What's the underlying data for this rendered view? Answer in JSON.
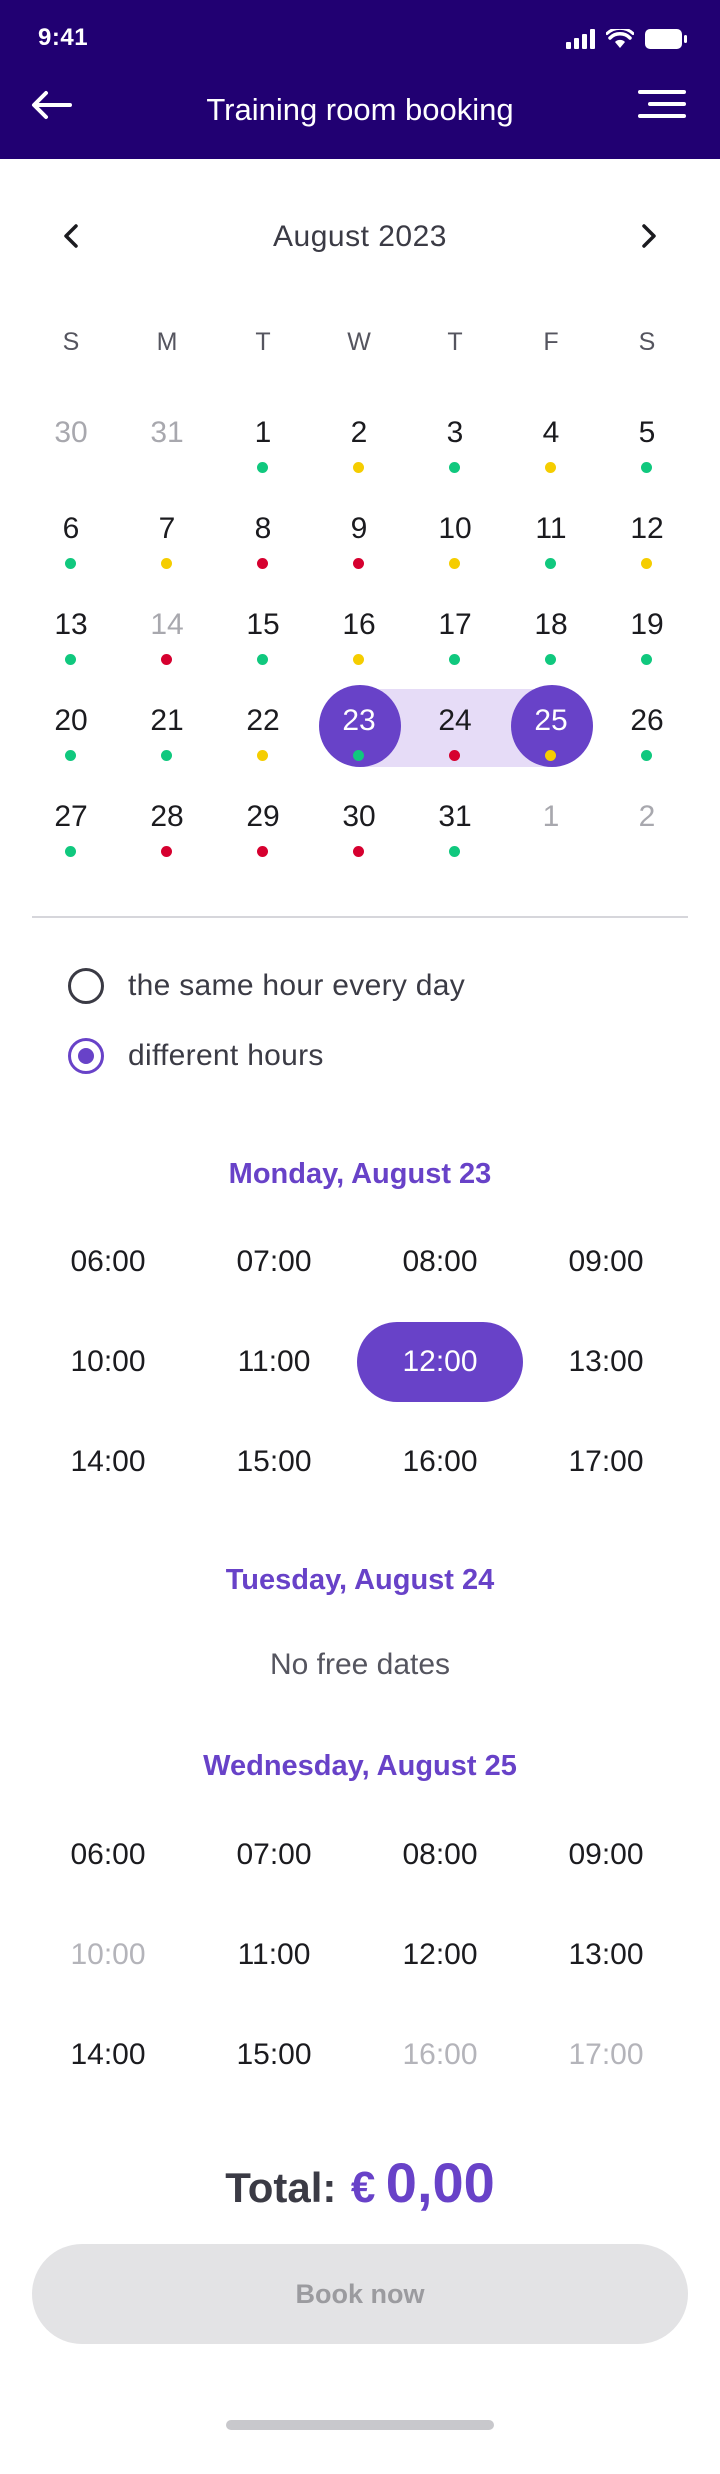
{
  "status_bar": {
    "time": "9:41",
    "icons": [
      "signal-icon",
      "wifi-icon",
      "battery-icon"
    ]
  },
  "header": {
    "title": "Training room booking",
    "back_icon": "arrow-left-icon",
    "menu_icon": "menu-icon"
  },
  "calendar": {
    "month_label": "August 2023",
    "weekdays": [
      "S",
      "M",
      "T",
      "W",
      "T",
      "F",
      "S"
    ],
    "weeks": [
      [
        {
          "day": "30",
          "other": true
        },
        {
          "day": "31",
          "other": true
        },
        {
          "day": "1",
          "status": "green"
        },
        {
          "day": "2",
          "status": "yellow"
        },
        {
          "day": "3",
          "status": "green"
        },
        {
          "day": "4",
          "status": "yellow"
        },
        {
          "day": "5",
          "status": "green"
        }
      ],
      [
        {
          "day": "6",
          "status": "green"
        },
        {
          "day": "7",
          "status": "yellow"
        },
        {
          "day": "8",
          "status": "red"
        },
        {
          "day": "9",
          "status": "red"
        },
        {
          "day": "10",
          "status": "yellow"
        },
        {
          "day": "11",
          "status": "green"
        },
        {
          "day": "12",
          "status": "yellow"
        }
      ],
      [
        {
          "day": "13",
          "status": "green"
        },
        {
          "day": "14",
          "status": "red",
          "dim": true
        },
        {
          "day": "15",
          "status": "green"
        },
        {
          "day": "16",
          "status": "yellow"
        },
        {
          "day": "17",
          "status": "green"
        },
        {
          "day": "18",
          "status": "green"
        },
        {
          "day": "19",
          "status": "green"
        }
      ],
      [
        {
          "day": "20",
          "status": "green"
        },
        {
          "day": "21",
          "status": "green"
        },
        {
          "day": "22",
          "status": "yellow"
        },
        {
          "day": "23",
          "status": "green",
          "selected": true
        },
        {
          "day": "24",
          "status": "red",
          "in_range": true
        },
        {
          "day": "25",
          "status": "yellow",
          "selected": true
        },
        {
          "day": "26",
          "status": "green"
        }
      ],
      [
        {
          "day": "27",
          "status": "green"
        },
        {
          "day": "28",
          "status": "red"
        },
        {
          "day": "29",
          "status": "red"
        },
        {
          "day": "30",
          "status": "red"
        },
        {
          "day": "31",
          "status": "green"
        },
        {
          "day": "1",
          "other": true
        },
        {
          "day": "2",
          "other": true
        }
      ]
    ],
    "colors": {
      "green": "#10c87e",
      "yellow": "#f5cd00",
      "red": "#d6002f",
      "accent": "#6842c8",
      "range": "#e6dcf7",
      "header": "#210072"
    }
  },
  "options": {
    "same_hour_label": "the same hour every day",
    "different_hours_label": "different hours",
    "selected": "different_hours"
  },
  "days": [
    {
      "heading": "Monday, August 23",
      "slots": [
        {
          "time": "06:00"
        },
        {
          "time": "07:00"
        },
        {
          "time": "08:00"
        },
        {
          "time": "09:00"
        },
        {
          "time": "10:00"
        },
        {
          "time": "11:00"
        },
        {
          "time": "12:00",
          "selected": true
        },
        {
          "time": "13:00"
        },
        {
          "time": "14:00"
        },
        {
          "time": "15:00"
        },
        {
          "time": "16:00"
        },
        {
          "time": "17:00"
        }
      ]
    },
    {
      "heading": "Tuesday, August 24",
      "empty_text": "No free dates",
      "slots": []
    },
    {
      "heading": "Wednesday, August 25",
      "slots": [
        {
          "time": "06:00"
        },
        {
          "time": "07:00"
        },
        {
          "time": "08:00"
        },
        {
          "time": "09:00"
        },
        {
          "time": "10:00",
          "disabled": true
        },
        {
          "time": "11:00"
        },
        {
          "time": "12:00"
        },
        {
          "time": "13:00"
        },
        {
          "time": "14:00"
        },
        {
          "time": "15:00"
        },
        {
          "time": "16:00",
          "disabled": true
        },
        {
          "time": "17:00",
          "disabled": true
        }
      ]
    }
  ],
  "total": {
    "label": "Total:",
    "currency": "€",
    "value": "0,00"
  },
  "book_button": {
    "label": "Book now",
    "enabled": false
  }
}
